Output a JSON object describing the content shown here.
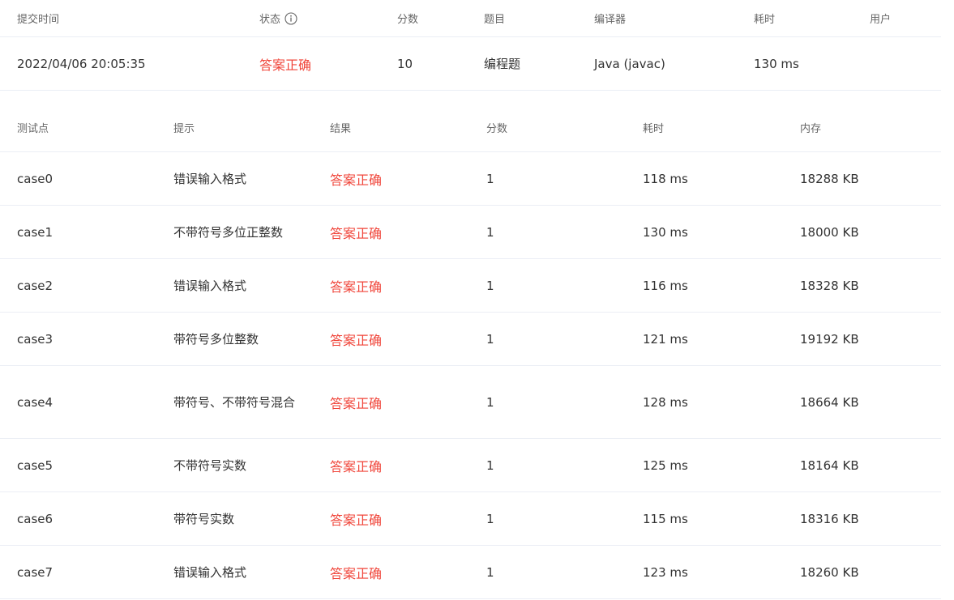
{
  "submission": {
    "headers": {
      "time": "提交时间",
      "status": "状态",
      "score": "分数",
      "problem": "题目",
      "compiler": "编译器",
      "elapsed": "耗时",
      "user": "用户"
    },
    "status_info_icon": "info-circle-icon",
    "row": {
      "time": "2022/04/06 20:05:35",
      "status": "答案正确",
      "score": "10",
      "problem": "编程题",
      "compiler": "Java (javac)",
      "elapsed": "130 ms",
      "user": ""
    }
  },
  "testcases": {
    "headers": {
      "case": "测试点",
      "hint": "提示",
      "result": "结果",
      "score": "分数",
      "elapsed": "耗时",
      "memory": "内存"
    },
    "rows": [
      {
        "case": "case0",
        "hint": "错误输入格式",
        "result": "答案正确",
        "score": "1",
        "elapsed": "118 ms",
        "memory": "18288 KB"
      },
      {
        "case": "case1",
        "hint": "不带符号多位正整数",
        "result": "答案正确",
        "score": "1",
        "elapsed": "130 ms",
        "memory": "18000 KB"
      },
      {
        "case": "case2",
        "hint": "错误输入格式",
        "result": "答案正确",
        "score": "1",
        "elapsed": "116 ms",
        "memory": "18328 KB"
      },
      {
        "case": "case3",
        "hint": "带符号多位整数",
        "result": "答案正确",
        "score": "1",
        "elapsed": "121 ms",
        "memory": "19192 KB"
      },
      {
        "case": "case4",
        "hint": "带符号、不带符号混合",
        "result": "答案正确",
        "score": "1",
        "elapsed": "128 ms",
        "memory": "18664 KB"
      },
      {
        "case": "case5",
        "hint": "不带符号实数",
        "result": "答案正确",
        "score": "1",
        "elapsed": "125 ms",
        "memory": "18164 KB"
      },
      {
        "case": "case6",
        "hint": "带符号实数",
        "result": "答案正确",
        "score": "1",
        "elapsed": "115 ms",
        "memory": "18316 KB"
      },
      {
        "case": "case7",
        "hint": "错误输入格式",
        "result": "答案正确",
        "score": "1",
        "elapsed": "123 ms",
        "memory": "18260 KB"
      }
    ]
  },
  "colors": {
    "accepted": "#f0453a",
    "divider": "#ebeef5",
    "header_text": "#666666",
    "body_text": "#333333"
  }
}
